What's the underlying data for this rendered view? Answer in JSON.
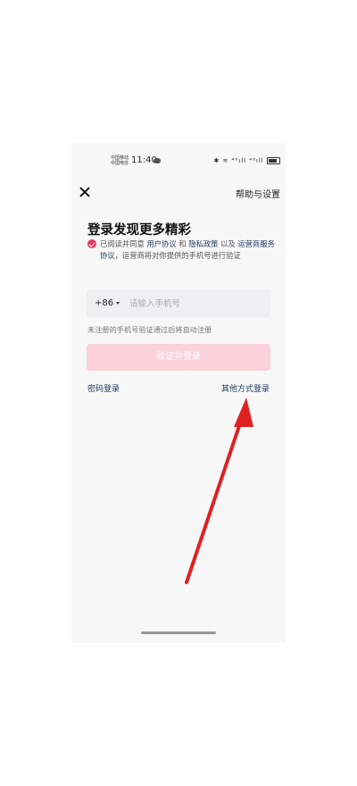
{
  "status_bar": {
    "carrier_line1": "中国移动",
    "carrier_line2": "中国电信",
    "time": "11:40",
    "right_icons": "✱ ≋ ⁴⁶ıll ⁴⁶ıll"
  },
  "header": {
    "close_icon": "close-icon",
    "help_label": "帮助与设置"
  },
  "main": {
    "title": "登录发现更多精彩",
    "consent": {
      "checked": true,
      "prefix": "已阅读并同意",
      "user_agreement": "用户协议",
      "and": "和",
      "privacy_policy": "隐私政策",
      "and_also": "以及",
      "operator_agreement": "运营商服务协议",
      "suffix": "，运营商将对你提供的手机号进行验证"
    },
    "phone": {
      "country_code": "+86",
      "placeholder": "请输入手机号",
      "value": ""
    },
    "hint": "未注册的手机号验证通过后将自动注册",
    "submit_label": "验证并登录",
    "password_login": "密码登录",
    "other_login": "其他方式登录"
  },
  "colors": {
    "accent": "#e8375a",
    "button_disabled": "#fcd1d9",
    "link": "#1e3a5f",
    "annotation_arrow": "#e02020"
  }
}
